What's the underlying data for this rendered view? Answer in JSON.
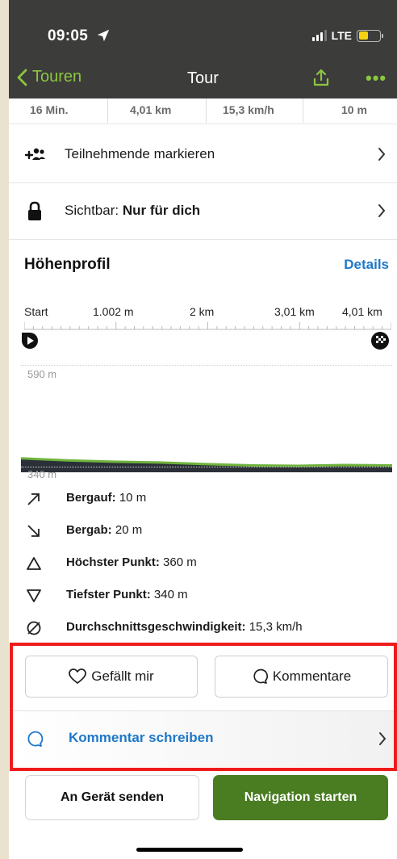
{
  "status_bar": {
    "time": "09:05",
    "network": "LTE",
    "battery_level": 0.45
  },
  "nav_bar": {
    "back_label": "Touren",
    "title": "Tour",
    "more_label": "•••"
  },
  "stats": [
    "16 Min.",
    "4,01 km",
    "15,3 km/h",
    "10 m"
  ],
  "participants": {
    "label": "Teilnehmende markieren"
  },
  "visibility": {
    "label_prefix": "Sichtbar:",
    "label_value": "Nur für dich"
  },
  "elevation_profile": {
    "title": "Höhenprofil",
    "details_link": "Details",
    "x_labels": [
      "Start",
      "1.002 m",
      "2 km",
      "3,01 km",
      "4,01 km"
    ],
    "y_top_label": "590 m",
    "y_bottom_label": "340 m"
  },
  "chart_data": {
    "type": "area",
    "xlabel": "",
    "ylabel": "",
    "x_ticks": [
      "Start",
      "1.002 m",
      "2 km",
      "3,01 km",
      "4,01 km"
    ],
    "ylim": [
      340,
      590
    ],
    "x_km": [
      0,
      0.5,
      1.0,
      1.5,
      2.0,
      2.5,
      3.0,
      3.5,
      4.01
    ],
    "elevation_m": [
      360,
      355,
      352,
      350,
      346,
      343,
      342,
      344,
      343
    ],
    "series_colors": {
      "surface": "#6fb33d",
      "fill": "#2b3038"
    }
  },
  "metrics": [
    {
      "icon": "arrow-up-right-icon",
      "label": "Bergauf:",
      "value": "10 m"
    },
    {
      "icon": "arrow-down-right-icon",
      "label": "Bergab:",
      "value": "20 m"
    },
    {
      "icon": "triangle-up-icon",
      "label": "Höchster Punkt:",
      "value": "360 m"
    },
    {
      "icon": "triangle-down-icon",
      "label": "Tiefster Punkt:",
      "value": "340 m"
    },
    {
      "icon": "average-icon",
      "label": "Durchschnittsgeschwindigkeit:",
      "value": "15,3 km/h"
    }
  ],
  "social": {
    "like_label": "Gefällt mir",
    "comments_label": "Kommentare",
    "write_comment_label": "Kommentar schreiben"
  },
  "actions": {
    "send_label": "An Gerät senden",
    "navigate_label": "Navigation starten"
  },
  "colors": {
    "accent_green": "#8cc63f",
    "link_blue": "#1e78c8",
    "primary_button": "#4a7c22",
    "highlight_red": "#ee1b1b",
    "header_bg": "#3c3c3b"
  }
}
